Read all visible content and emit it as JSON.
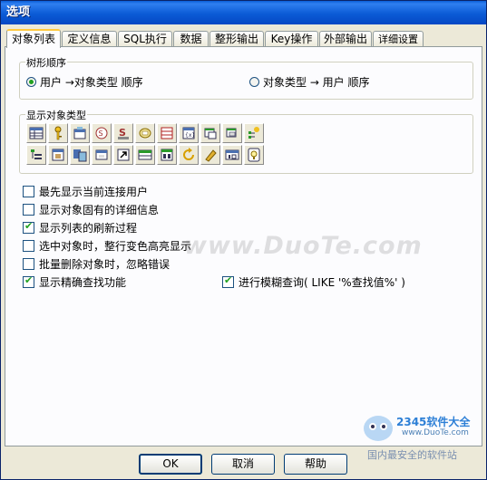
{
  "window": {
    "title": "选项"
  },
  "tabs": [
    {
      "label": "对象列表"
    },
    {
      "label": "定义信息"
    },
    {
      "label": "SQL执行"
    },
    {
      "label": "数据"
    },
    {
      "label": "整形输出"
    },
    {
      "label": "Key操作"
    },
    {
      "label": "外部输出"
    },
    {
      "label": "详细设置"
    }
  ],
  "tree_order": {
    "title": "树形顺序",
    "options": [
      {
        "label": "用户 →对象类型 顺序",
        "selected": true
      },
      {
        "label": "对象类型 → 用户 顺序",
        "selected": false
      }
    ]
  },
  "object_types": {
    "title": "显示对象类型",
    "icons": [
      "table-icon",
      "key-icon",
      "index-icon",
      "sequence-icon",
      "synonym-icon",
      "procedure-icon",
      "function-icon",
      "package-icon",
      "package-body-icon",
      "trigger-icon",
      "user-tree-icon",
      "grid-icon",
      "db-link-icon",
      "view-icon",
      "shortcut-icon",
      "materialized-view-icon",
      "cluster-icon",
      "refresh-icon",
      "java-icon",
      "library-icon",
      "tip-icon"
    ]
  },
  "options": [
    {
      "label": "最先显示当前连接用户",
      "checked": false
    },
    {
      "label": "显示对象固有的详细信息",
      "checked": false
    },
    {
      "label": "显示列表的刷新过程",
      "checked": true
    },
    {
      "label": "选中对象时，整行变色高亮显示",
      "checked": false
    },
    {
      "label": "批量删除对象时，忽略错误",
      "checked": false
    },
    {
      "label": "显示精确查找功能",
      "checked": true
    }
  ],
  "fuzzy_search": {
    "label": "进行模糊查询( LIKE '%查找值%' )",
    "checked": true
  },
  "buttons": {
    "ok": "OK",
    "cancel": "取消",
    "help": "帮助"
  },
  "watermark": {
    "text": "www.DuoTe.com",
    "brand": "2345软件大全",
    "url": "www.DuoTe.com",
    "slogan": "国内最安全的软件站"
  },
  "colors": {
    "titlebar": "#0b5bd6",
    "dialog": "#ece9d8",
    "active_tab_accent": "#ffc83c",
    "check_mark": "#21a121"
  }
}
